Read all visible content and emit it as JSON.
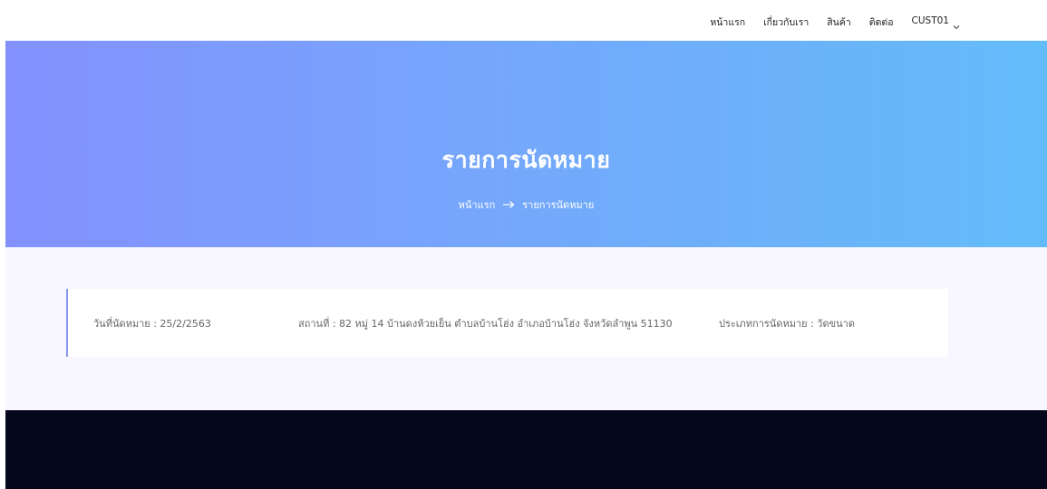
{
  "nav": {
    "items": [
      {
        "label": "หน้าแรก"
      },
      {
        "label": "เกี่ยวกับเรา"
      },
      {
        "label": "สินค้า"
      },
      {
        "label": "ติดต่อ"
      }
    ],
    "user_label": "CUST01",
    "chevron_icon": "chevron-down-icon"
  },
  "hero": {
    "title": "รายการนัดหมาย",
    "breadcrumb": {
      "home": "หน้าแรก",
      "separator_icon": "arrow-right-icon",
      "current": "รายการนัดหมาย"
    },
    "gradient": [
      "#8391ff",
      "#63bcfa"
    ]
  },
  "appointment": {
    "date_text": "วันที่นัดหมาย : 25/2/2563",
    "place_text": "สถานที่ : 82 หมู่ 14 บ้านดงห้วยเย็น ตำบลบ้านโฮ่ง อำเภอบ้านโฮ่ง จังหวัดลำพูน 51130",
    "type_text": "ประเภทการนัดหมาย : วัดขนาด"
  },
  "colors": {
    "accent_border": "#8a96ee",
    "section_bg": "#f8f7ff",
    "footer_bg": "#04081a"
  }
}
